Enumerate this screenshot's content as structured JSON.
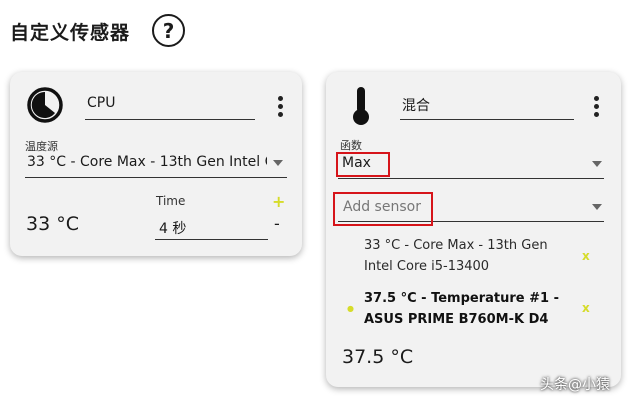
{
  "header": {
    "title": "自定义传感器",
    "help_label": "?"
  },
  "cpu_card": {
    "name": "CPU",
    "source_label": "温度源",
    "source_value": "33 °C - Core Max - 13th Gen Intel C",
    "time_label": "Time",
    "time_value": "4 秒",
    "current_value": "33 °C",
    "add_label": "+",
    "remove_label": "-"
  },
  "mix_card": {
    "name": "混合",
    "function_label": "函数",
    "function_value": "Max",
    "add_sensor_placeholder": "Add sensor",
    "sensors": [
      {
        "line1": "33 °C - Core Max - 13th Gen",
        "line2": "Intel Core i5-13400",
        "remove_label": "x"
      },
      {
        "line1": "37.5 °C - Temperature #1 -",
        "line2": "ASUS PRIME B760M-K D4",
        "remove_label": "x"
      }
    ],
    "current_value": "37.5 °C"
  },
  "watermark": "头条@小猿",
  "colors": {
    "accent_yellow": "#d6dc2a",
    "highlight_red": "#d6141a",
    "card_bg": "#f2f2f2"
  },
  "icons": {
    "cpu_card": "clock-pie-icon",
    "mix_card": "thermometer-icon"
  }
}
